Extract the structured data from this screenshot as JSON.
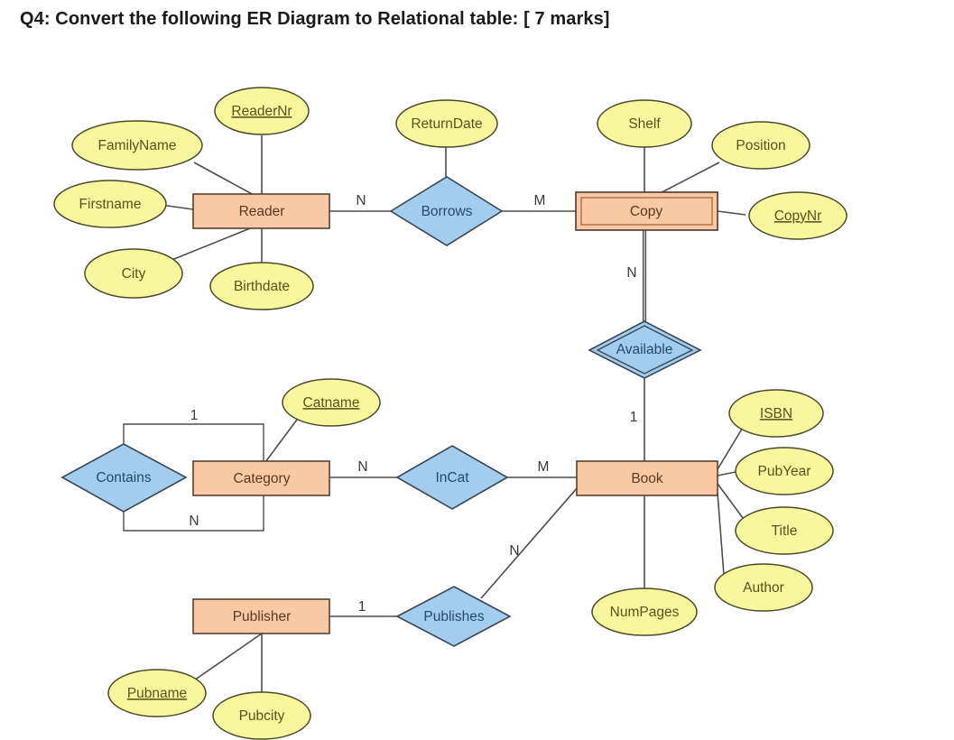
{
  "page": {
    "title": "Q4: Convert the following ER Diagram to Relational table: [ 7 marks]",
    "background_color": "#ffffff"
  },
  "palette": {
    "entity_fill": "#f9c9a3",
    "entity_stroke": "#5a4032",
    "attribute_fill": "#f7f79e",
    "attribute_stroke": "#4a4a2a",
    "relationship_fill": "#a2cdee",
    "relationship_stroke": "#3a4652",
    "line_color": "#4d4d4d",
    "title_color": "#1a1a1a"
  },
  "diagram": {
    "kind": "er-diagram",
    "notation": "Chen",
    "entities": [
      {
        "id": "reader",
        "label": "Reader",
        "weak": false
      },
      {
        "id": "copy",
        "label": "Copy",
        "weak": true
      },
      {
        "id": "category",
        "label": "Category",
        "weak": false
      },
      {
        "id": "book",
        "label": "Book",
        "weak": false
      },
      {
        "id": "publisher",
        "label": "Publisher",
        "weak": false
      }
    ],
    "relationships": [
      {
        "id": "borrows",
        "label": "Borrows",
        "identifying": false
      },
      {
        "id": "available",
        "label": "Available",
        "identifying": true
      },
      {
        "id": "contains",
        "label": "Contains",
        "identifying": false
      },
      {
        "id": "incat",
        "label": "InCat",
        "identifying": false
      },
      {
        "id": "publishes",
        "label": "Publishes",
        "identifying": false
      }
    ],
    "attributes": [
      {
        "id": "readernr",
        "label": "ReaderNr",
        "owner": "reader",
        "key": true
      },
      {
        "id": "familyname",
        "label": "FamilyName",
        "owner": "reader",
        "key": false
      },
      {
        "id": "firstname",
        "label": "Firstname",
        "owner": "reader",
        "key": false
      },
      {
        "id": "city",
        "label": "City",
        "owner": "reader",
        "key": false
      },
      {
        "id": "birthdate",
        "label": "Birthdate",
        "owner": "reader",
        "key": false
      },
      {
        "id": "returndate",
        "label": "ReturnDate",
        "owner": "borrows",
        "key": false
      },
      {
        "id": "shelf",
        "label": "Shelf",
        "owner": "copy",
        "key": false
      },
      {
        "id": "position",
        "label": "Position",
        "owner": "copy",
        "key": false
      },
      {
        "id": "copynr",
        "label": "CopyNr",
        "owner": "copy",
        "key": true
      },
      {
        "id": "catname",
        "label": "Catname",
        "owner": "category",
        "key": true
      },
      {
        "id": "isbn",
        "label": "ISBN",
        "owner": "book",
        "key": true
      },
      {
        "id": "pubyear",
        "label": "PubYear",
        "owner": "book",
        "key": false
      },
      {
        "id": "title",
        "label": "Title",
        "owner": "book",
        "key": false
      },
      {
        "id": "author",
        "label": "Author",
        "owner": "book",
        "key": false
      },
      {
        "id": "numpages",
        "label": "NumPages",
        "owner": "book",
        "key": false
      },
      {
        "id": "pubname",
        "label": "Pubname",
        "owner": "publisher",
        "key": true
      },
      {
        "id": "pubcity",
        "label": "Pubcity",
        "owner": "publisher",
        "key": false
      }
    ],
    "cardinalities": [
      {
        "id": "card-reader-borrows",
        "label": "N",
        "from": "reader",
        "to": "borrows"
      },
      {
        "id": "card-borrows-copy",
        "label": "M",
        "from": "borrows",
        "to": "copy"
      },
      {
        "id": "card-copy-available",
        "label": "N",
        "from": "copy",
        "to": "available"
      },
      {
        "id": "card-available-book",
        "label": "1",
        "from": "available",
        "to": "book"
      },
      {
        "id": "card-contains-one",
        "label": "1",
        "from": "contains",
        "to": "category"
      },
      {
        "id": "card-contains-many",
        "label": "N",
        "from": "contains",
        "to": "category"
      },
      {
        "id": "card-category-incat",
        "label": "N",
        "from": "category",
        "to": "incat"
      },
      {
        "id": "card-incat-book",
        "label": "M",
        "from": "incat",
        "to": "book"
      },
      {
        "id": "card-publisher-pub",
        "label": "1",
        "from": "publisher",
        "to": "publishes"
      },
      {
        "id": "card-publishes-book",
        "label": "N",
        "from": "publishes",
        "to": "book"
      }
    ]
  }
}
